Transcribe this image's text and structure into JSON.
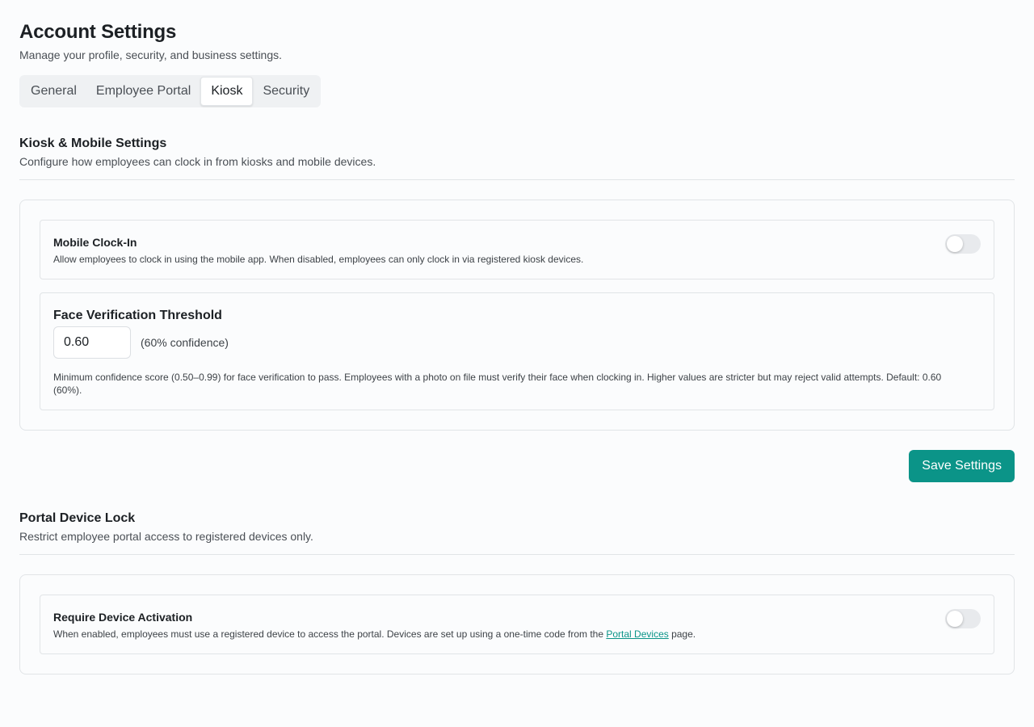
{
  "header": {
    "title": "Account Settings",
    "subtitle": "Manage your profile, security, and business settings."
  },
  "tabs": [
    {
      "label": "General",
      "active": false
    },
    {
      "label": "Employee Portal",
      "active": false
    },
    {
      "label": "Kiosk",
      "active": true
    },
    {
      "label": "Security",
      "active": false
    }
  ],
  "kiosk_section": {
    "title": "Kiosk & Mobile Settings",
    "description": "Configure how employees can clock in from kiosks and mobile devices.",
    "mobile_clock_in": {
      "title": "Mobile Clock-In",
      "description": "Allow employees to clock in using the mobile app. When disabled, employees can only clock in via registered kiosk devices.",
      "enabled": false
    },
    "face_threshold": {
      "title": "Face Verification Threshold",
      "value": "0.60",
      "hint": "(60% confidence)",
      "description": "Minimum confidence score (0.50–0.99) for face verification to pass. Employees with a photo on file must verify their face when clocking in. Higher values are stricter but may reject valid attempts. Default: 0.60 (60%)."
    },
    "save_label": "Save Settings"
  },
  "device_lock_section": {
    "title": "Portal Device Lock",
    "description": "Restrict employee portal access to registered devices only.",
    "require_activation": {
      "title": "Require Device Activation",
      "description_prefix": "When enabled, employees must use a registered device to access the portal. Devices are set up using a one-time code from the ",
      "link_text": "Portal Devices",
      "description_suffix": " page.",
      "enabled": false
    }
  },
  "colors": {
    "accent": "#0b9488",
    "toggle_off": "#e8eaed"
  }
}
